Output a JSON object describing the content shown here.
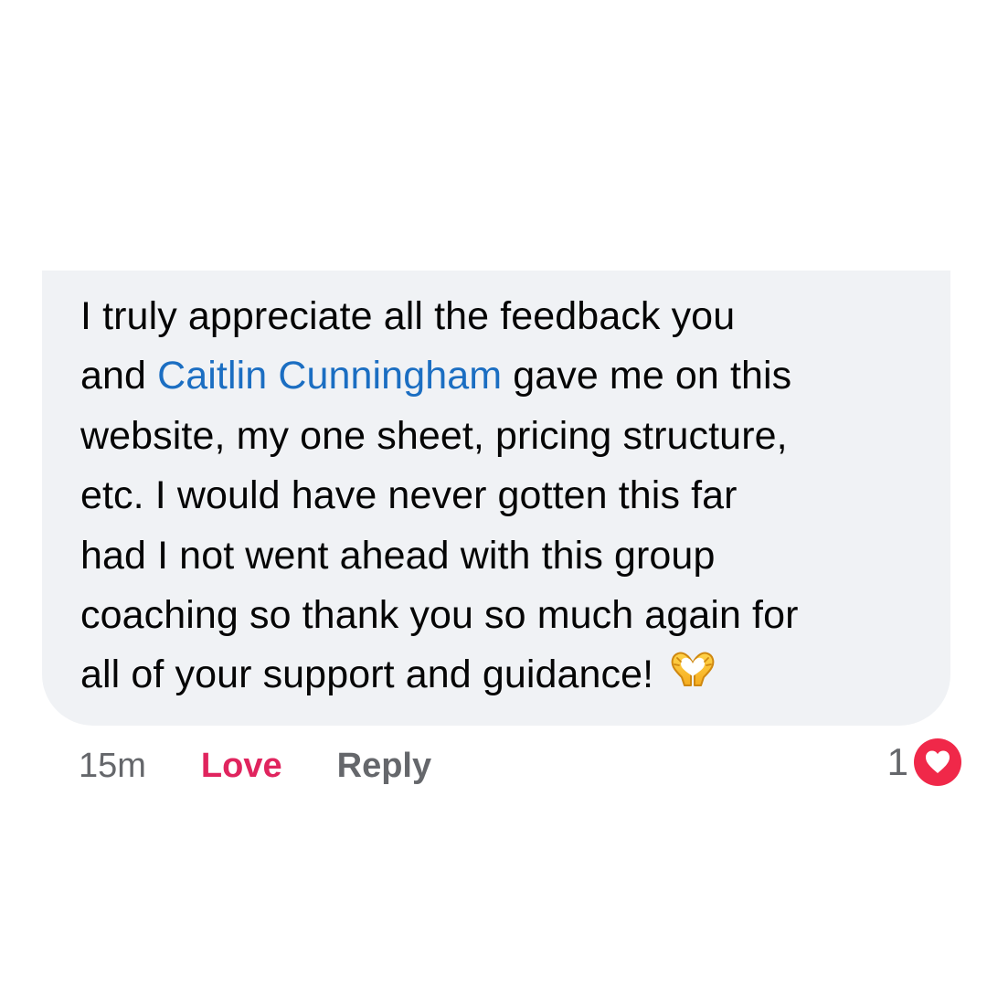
{
  "comment": {
    "text_before_mention": "I truly appreciate all the feedback you and ",
    "mention": "Caitlin Cunningham",
    "text_after_mention": " gave me on this website, my one sheet, pricing structure, etc. I would have never gotten this far had I not went ahead with this group coaching so thank you so much again for all of your support and guidance!",
    "emoji_icon": "heart-hands-icon",
    "timestamp": "15m"
  },
  "actions": {
    "love_label": "Love",
    "reply_label": "Reply"
  },
  "reactions": {
    "count": "1",
    "icon": "heart-icon"
  },
  "colors": {
    "bubble_background": "#f0f2f5",
    "mention": "#1b6ec2",
    "love": "#e0245e",
    "meta_text": "#65676b",
    "heart_badge": "#f02849"
  }
}
